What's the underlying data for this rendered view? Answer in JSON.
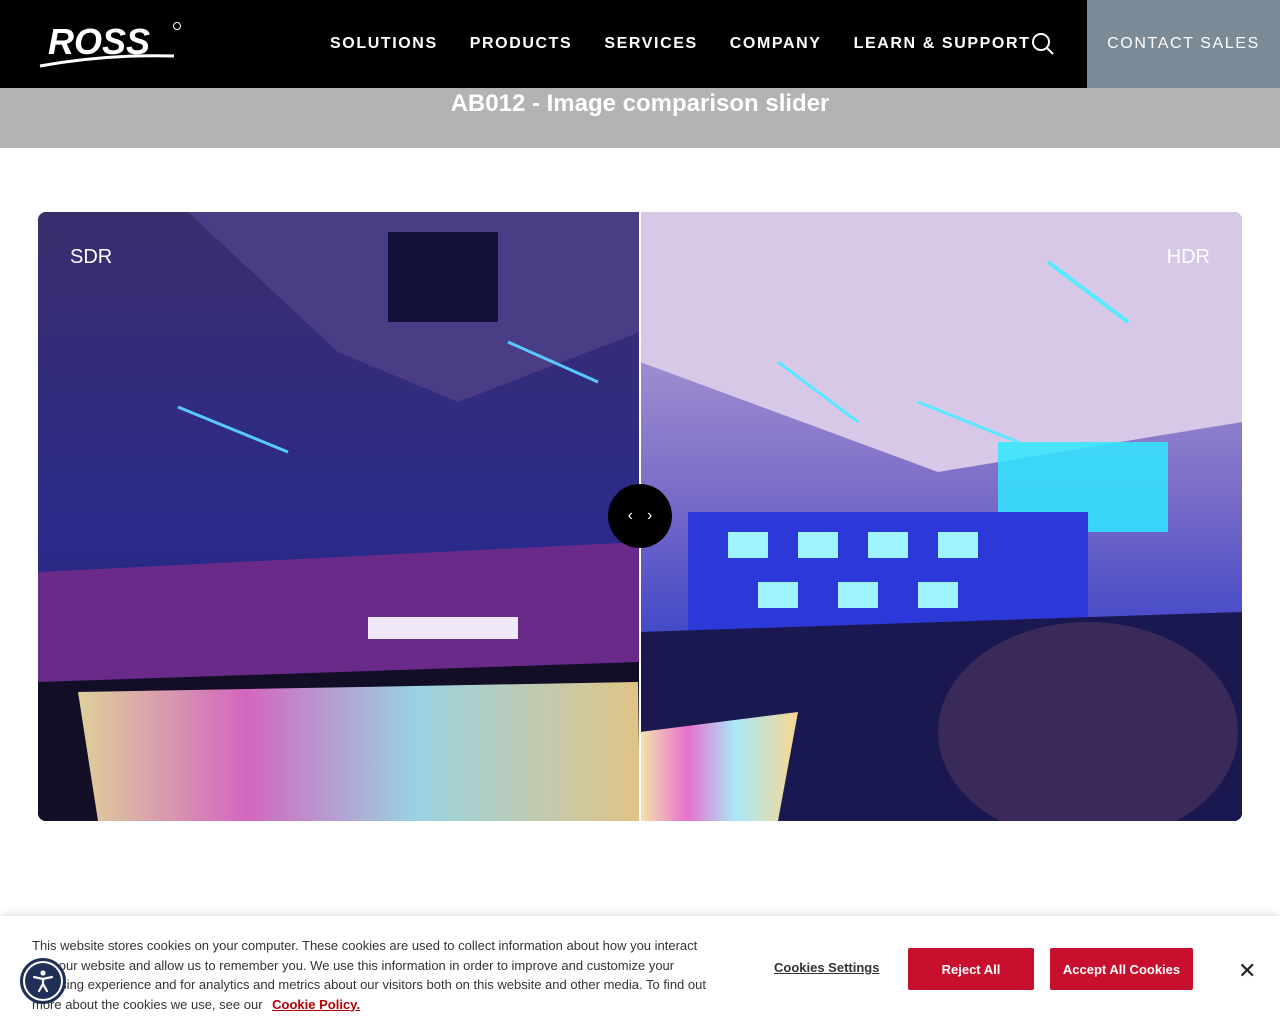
{
  "header": {
    "logo_text": "ROSS",
    "nav": [
      "SOLUTIONS",
      "PRODUCTS",
      "SERVICES",
      "COMPANY",
      "LEARN & SUPPORT"
    ],
    "search_icon": "search-icon",
    "contact_label": "CONTACT SALES"
  },
  "page": {
    "title": "AB012 - Image comparison slider"
  },
  "slider": {
    "left_label": "SDR",
    "right_label": "HDR",
    "position_fraction": 0.5,
    "handle_left_icon": "chevron-left-icon",
    "handle_right_icon": "chevron-right-icon"
  },
  "cookie": {
    "text": "This website stores cookies on your computer. These cookies are used to collect information about how you interact with our website and allow us to remember you. We use this information in order to improve and customize your browsing experience and for analytics and metrics about our visitors both on this website and other media. To find out more about the cookies we use, see our",
    "policy_link": "Cookie Policy.",
    "settings_label": "Cookies Settings",
    "reject_label": "Reject All",
    "accept_label": "Accept All Cookies",
    "close_icon": "close-icon"
  },
  "accessibility": {
    "icon": "accessibility-icon"
  },
  "colors": {
    "header_bg": "#000000",
    "contact_bg": "#7b8a97",
    "title_band": "#b3b3b3",
    "accent_red": "#c8102e",
    "a11y_blue": "#1f2f57"
  }
}
